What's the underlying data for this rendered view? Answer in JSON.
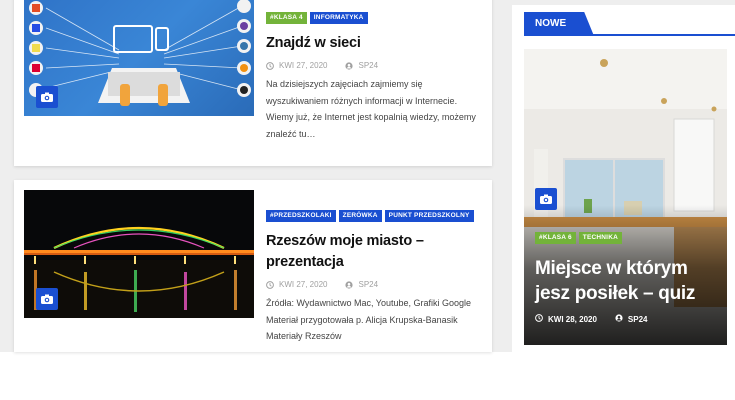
{
  "posts": [
    {
      "tags": [
        "#KLASA 4",
        "INFORMATYKA"
      ],
      "title": "Znajdź w sieci",
      "date": "KWI 27, 2020",
      "author": "SP24",
      "excerpt": "Na dzisiejszych zajęciach zajmiemy się wyszukiwaniem różnych informacji w Internecie. Wiemy już, że Internet jest kopalnią wiedzy, możemy znaleźć tu…"
    },
    {
      "tags": [
        "#PRZEDSZKOLAKI",
        "ZERÓWKA",
        "PUNKT PRZEDSZKOLNY"
      ],
      "title": "Rzeszów moje miasto – prezentacja",
      "date": "KWI 27, 2020",
      "author": "SP24",
      "excerpt": "Źródła: Wydawnictwo Mac, Youtube, Grafiki Google Materiał przygotowała p. Alicja Krupska-Banasik Materiały Rzeszów"
    }
  ],
  "sidebar": {
    "heading": "NOWE",
    "featured": {
      "tags": [
        "#KLASA 6",
        "TECHNIKA"
      ],
      "title": "Miejsce w którym jesz posiłek – quiz",
      "date": "KWI 28, 2020",
      "author": "SP24"
    }
  },
  "colors": {
    "accent": "#1a4fd1",
    "tag_green": "#73b33a"
  }
}
